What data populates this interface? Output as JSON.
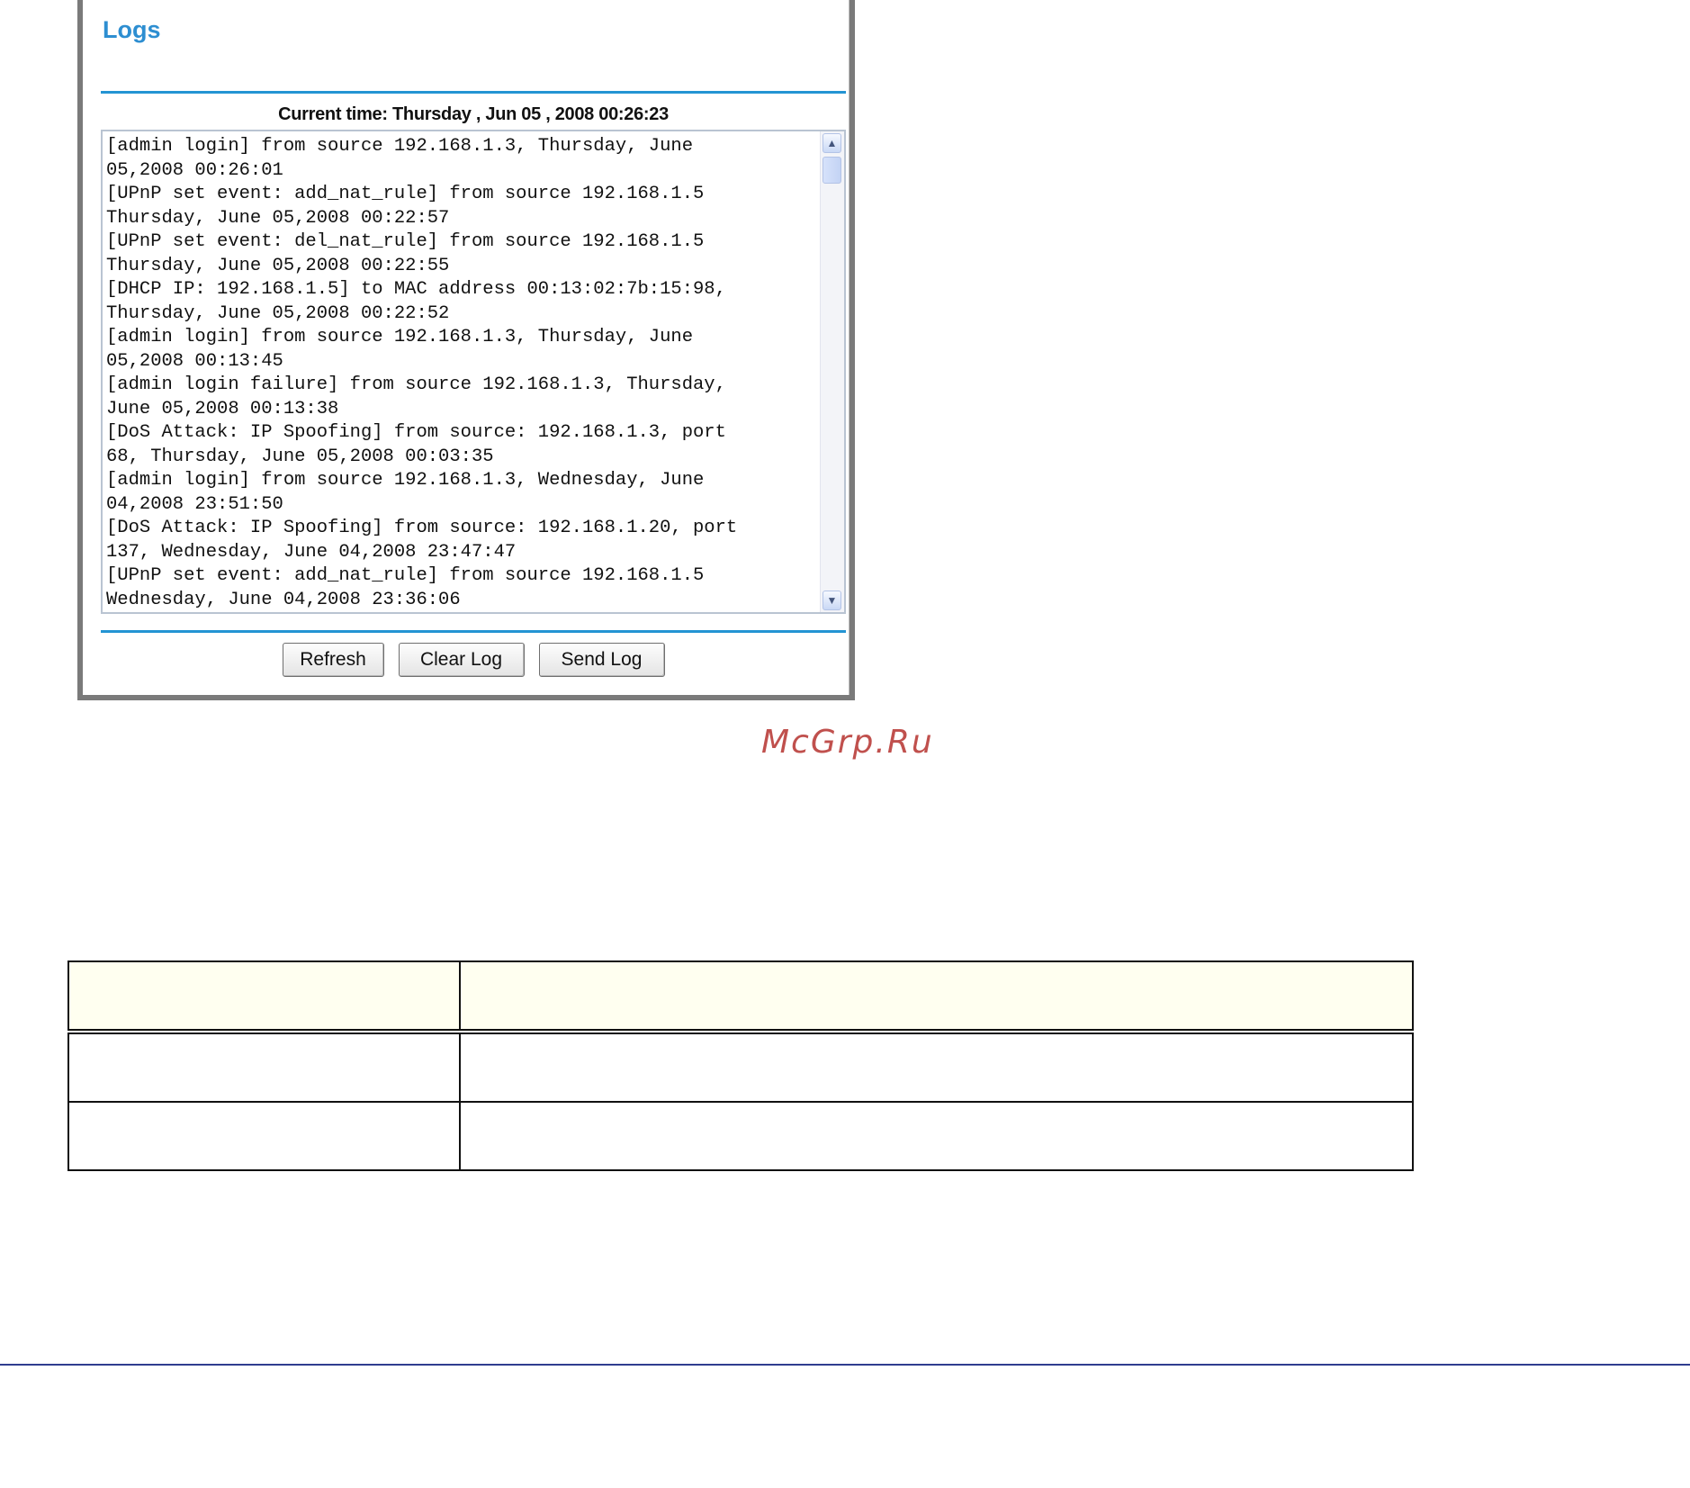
{
  "logs_panel": {
    "title": "Logs",
    "current_time": "Current time: Thursday , Jun 05 , 2008 00:26:23",
    "log_lines": [
      "[admin login] from source 192.168.1.3, Thursday, June",
      "05,2008 00:26:01",
      "[UPnP set event: add_nat_rule] from source 192.168.1.5",
      "Thursday, June 05,2008 00:22:57",
      "[UPnP set event: del_nat_rule] from source 192.168.1.5",
      "Thursday, June 05,2008 00:22:55",
      "[DHCP IP: 192.168.1.5] to MAC address 00:13:02:7b:15:98,",
      "Thursday, June 05,2008 00:22:52",
      "[admin login] from source 192.168.1.3, Thursday, June",
      "05,2008 00:13:45",
      "[admin login failure] from source 192.168.1.3, Thursday,",
      "June 05,2008 00:13:38",
      "[DoS Attack: IP Spoofing] from source: 192.168.1.3, port",
      "68, Thursday, June 05,2008 00:03:35",
      "[admin login] from source 192.168.1.3, Wednesday, June",
      "04,2008 23:51:50",
      "[DoS Attack: IP Spoofing] from source: 192.168.1.20, port",
      "137, Wednesday, June 04,2008 23:47:47",
      "[UPnP set event: add_nat_rule] from source 192.168.1.5",
      "Wednesday, June 04,2008 23:36:06"
    ],
    "buttons": {
      "refresh": "Refresh",
      "clear_log": "Clear Log",
      "send_log": "Send Log"
    }
  },
  "watermark": "McGrp.Ru",
  "table": {
    "header": [
      "",
      ""
    ],
    "rows": [
      [
        "",
        ""
      ],
      [
        "",
        ""
      ]
    ]
  }
}
